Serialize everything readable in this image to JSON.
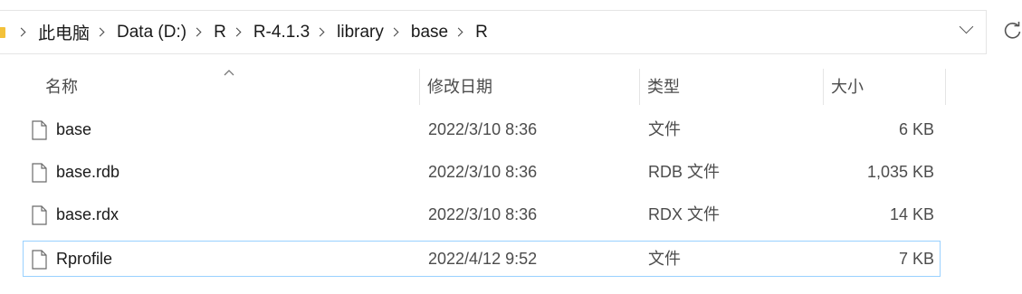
{
  "breadcrumb": {
    "items": [
      {
        "label": "此电脑"
      },
      {
        "label": "Data (D:)"
      },
      {
        "label": "R"
      },
      {
        "label": "R-4.1.3"
      },
      {
        "label": "library"
      },
      {
        "label": "base"
      },
      {
        "label": "R"
      }
    ]
  },
  "columns": {
    "name": "名称",
    "date": "修改日期",
    "type": "类型",
    "size": "大小"
  },
  "files": [
    {
      "name": "base",
      "date": "2022/3/10 8:36",
      "type": "文件",
      "size": "6 KB"
    },
    {
      "name": "base.rdb",
      "date": "2022/3/10 8:36",
      "type": "RDB 文件",
      "size": "1,035 KB"
    },
    {
      "name": "base.rdx",
      "date": "2022/3/10 8:36",
      "type": "RDX 文件",
      "size": "14 KB"
    },
    {
      "name": "Rprofile",
      "date": "2022/4/12 9:52",
      "type": "文件",
      "size": "7 KB"
    }
  ],
  "icons": {
    "folder": "folder-icon",
    "file": "file-icon",
    "chevron": "chevron-right-icon",
    "dropdown": "chevron-down-icon",
    "refresh": "refresh-icon",
    "sort": "sort-ascending-icon"
  },
  "colors": {
    "selection_border": "#99d1ff",
    "folder": "#f3c13a"
  }
}
